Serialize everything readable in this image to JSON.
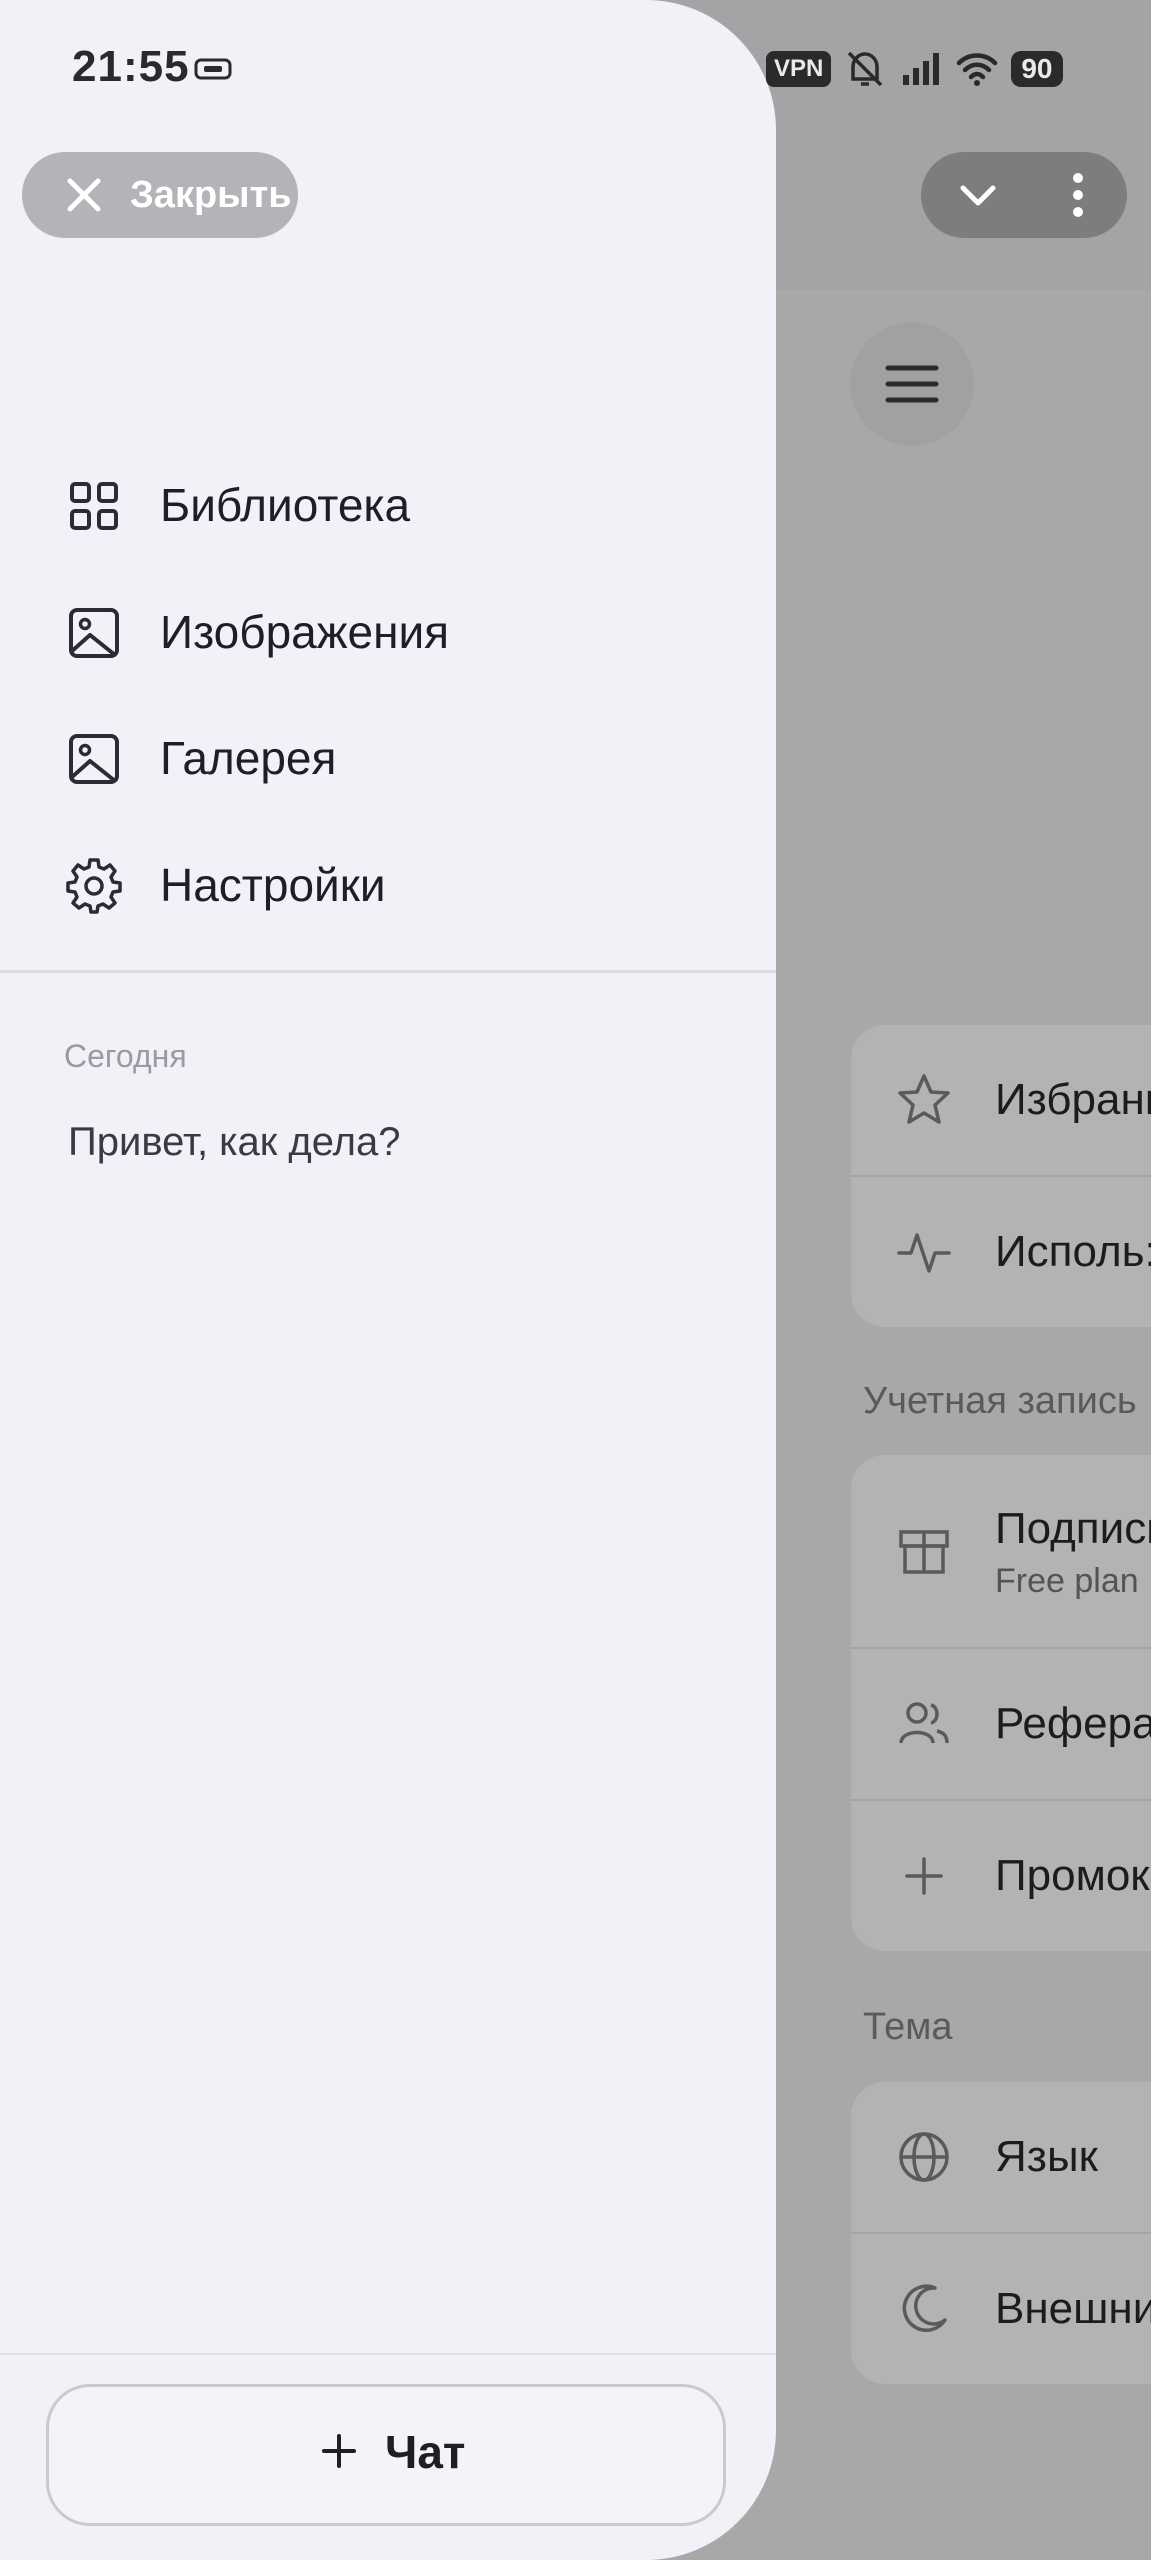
{
  "status_bar": {
    "time": "21:55",
    "vpn": "VPN",
    "battery": "90"
  },
  "header": {
    "close_label": "Закрыть"
  },
  "menu": [
    {
      "label": "Библиотека",
      "icon": "grid-icon"
    },
    {
      "label": "Изображения",
      "icon": "image-icon"
    },
    {
      "label": "Галерея",
      "icon": "image-icon"
    },
    {
      "label": "Настройки",
      "icon": "gear-icon"
    }
  ],
  "history": {
    "section": "Сегодня",
    "items": [
      "Привет, как дела?"
    ]
  },
  "new_chat": {
    "label": "Чат",
    "icon": "plus-icon"
  },
  "background_page": {
    "card1": [
      {
        "label": "Избранн",
        "icon": "star-icon"
      },
      {
        "label": "Исполь:",
        "icon": "activity-icon"
      }
    ],
    "account_section": "Учетная запись",
    "card2": [
      {
        "label": "Подписк",
        "sub": "Free plan",
        "icon": "gift-icon"
      },
      {
        "label": "Рефера.",
        "icon": "users-icon"
      },
      {
        "label": "Промок",
        "icon": "plus-icon"
      }
    ],
    "theme_section": "Тема",
    "card3": [
      {
        "label": "Язык",
        "icon": "globe-icon"
      },
      {
        "label": "Внешни",
        "icon": "moon-icon"
      }
    ]
  },
  "colors": {
    "drawer_bg": "#f1f1f7",
    "scrim": "#a8a8a8",
    "close_button": "#b3b3b8"
  }
}
